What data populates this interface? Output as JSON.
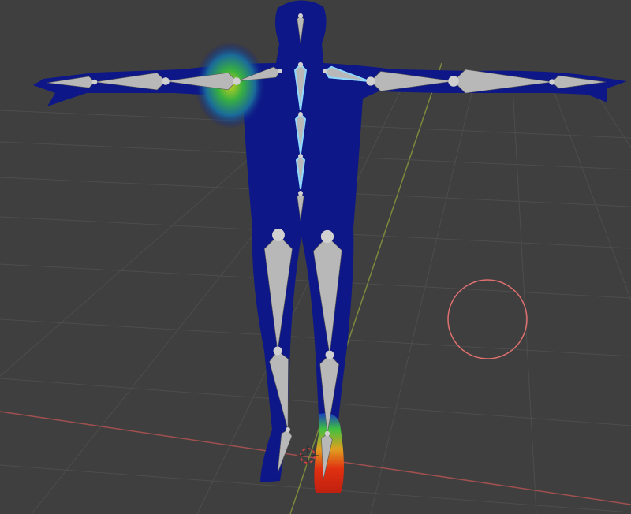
{
  "viewport": {
    "mode": "weight-paint",
    "colors": {
      "background": "#3f3f3f",
      "grid": "#4d4d4d",
      "x_axis": "#a0504f",
      "y_axis": "#7a8a3c",
      "mesh_base": "#0d1787",
      "bone": "#b8b8b8",
      "bone_selected": "#8fd8ff",
      "brush_circle": "#e07070"
    },
    "icons": [
      "3d-cursor-icon",
      "brush-circle-icon"
    ]
  }
}
